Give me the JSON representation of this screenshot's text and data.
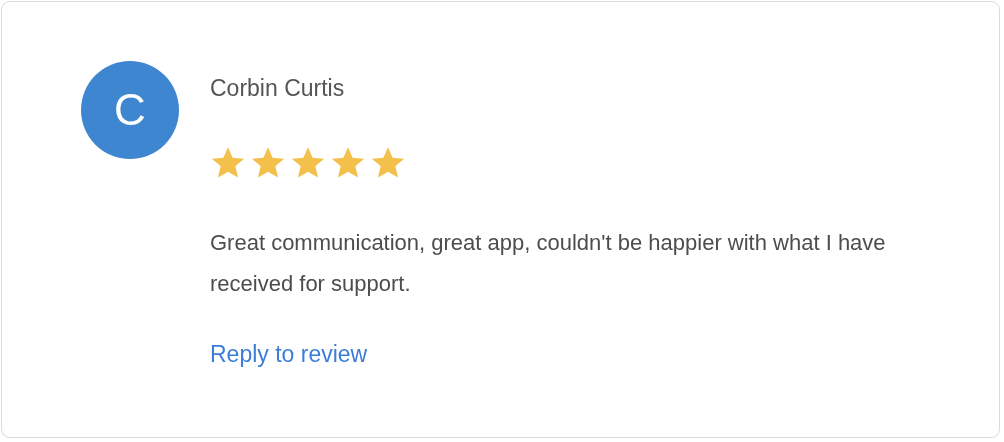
{
  "review": {
    "avatar_letter": "C",
    "author": "Corbin Curtis",
    "stars": 5,
    "text": "Great communication, great app, couldn't be happier with what I have received for support.",
    "reply_link": "Reply to review"
  }
}
